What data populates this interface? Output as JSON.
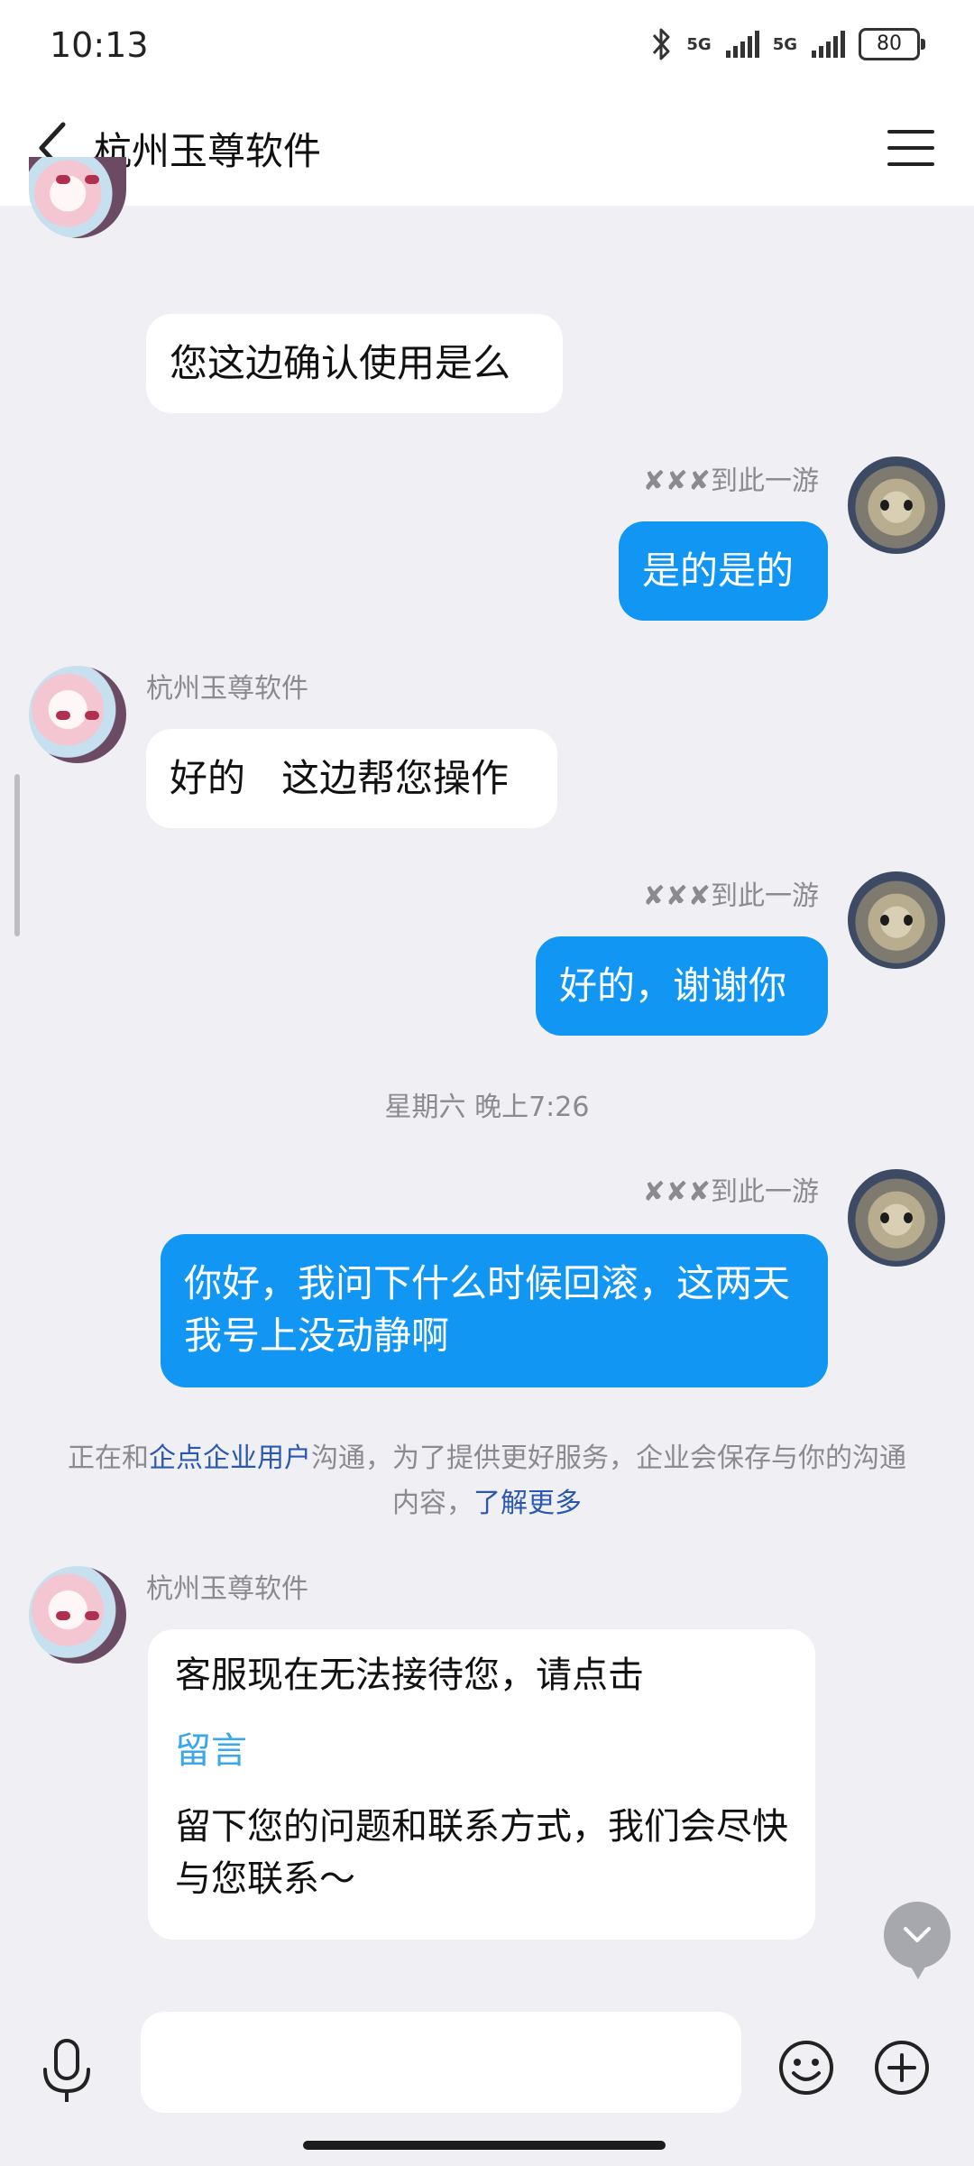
{
  "status": {
    "time": "10:13",
    "battery": "80",
    "net1": "5G",
    "net2": "5G",
    "icons": [
      "bluetooth-icon",
      "signal-icon",
      "signal-icon",
      "battery-icon"
    ]
  },
  "header": {
    "title": "杭州玉尊软件",
    "back_icon": "chevron-left-icon",
    "menu_icon": "menu-icon"
  },
  "messages": [
    {
      "side": "left",
      "sender": "",
      "text": "您这边确认使用是么"
    },
    {
      "side": "right",
      "sender": "✘✘✘到此一游",
      "text": "是的是的"
    },
    {
      "side": "left",
      "sender": "杭州玉尊软件",
      "text": "好的   这边帮您操作"
    },
    {
      "side": "right",
      "sender": "✘✘✘到此一游",
      "text": "好的，谢谢你"
    },
    {
      "side": "right",
      "sender": "✘✘✘到此一游",
      "text": "你好，我问下什么时候回滚，这两天我号上没动静啊"
    }
  ],
  "timestamp": "星期六 晚上7:26",
  "notice": {
    "prefix": "正在和",
    "link1": "企点企业用户",
    "middle": "沟通，为了提供更好服务，企业会保存与你的沟通内容，",
    "link2": "了解更多"
  },
  "card": {
    "sender": "杭州玉尊软件",
    "line1": "客服现在无法接待您，请点击",
    "link": "留言",
    "line2": "留下您的问题和联系方式，我们会尽快与您联系～"
  },
  "input": {
    "placeholder": "",
    "mic_icon": "microphone-icon",
    "emoji_icon": "emoji-icon",
    "plus_icon": "plus-icon"
  },
  "colors": {
    "accent": "#1296f3",
    "link": "#2a58b0",
    "card_link": "#3aa7ea",
    "background": "#efeff4"
  }
}
